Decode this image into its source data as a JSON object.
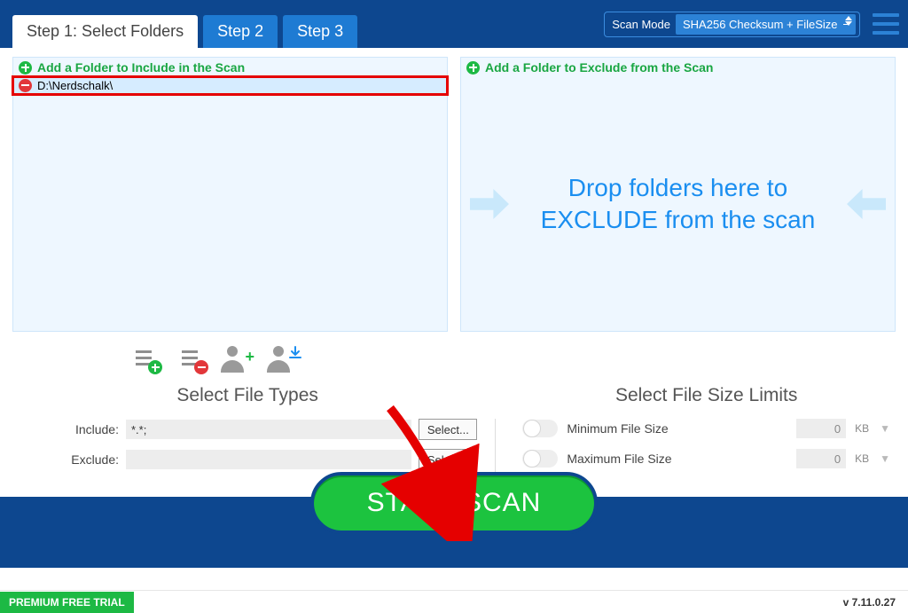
{
  "header": {
    "tabs": [
      {
        "label": "Step 1: Select Folders",
        "active": true
      },
      {
        "label": "Step 2",
        "active": false
      },
      {
        "label": "Step 3",
        "active": false
      }
    ],
    "scan_mode_label": "Scan Mode",
    "scan_mode_value": "SHA256 Checksum + FileSize"
  },
  "include_panel": {
    "header": "Add a Folder to Include in the Scan",
    "folders": [
      "D:\\Nerdschalk\\"
    ]
  },
  "exclude_panel": {
    "header": "Add a Folder to Exclude from the Scan",
    "drop_hint": "Drop folders here to EXCLUDE from the scan"
  },
  "file_types": {
    "title": "Select File Types",
    "include_label": "Include:",
    "include_value": "*.*;",
    "exclude_label": "Exclude:",
    "exclude_value": "",
    "select_btn": "Select..."
  },
  "size_limits": {
    "title": "Select File Size Limits",
    "min_label": "Minimum File Size",
    "max_label": "Maximum File Size",
    "min_value": "0",
    "max_value": "0",
    "unit": "KB"
  },
  "start_button": "START SCAN",
  "footer": {
    "trial": "PREMIUM FREE TRIAL",
    "version": "v 7.11.0.27"
  }
}
